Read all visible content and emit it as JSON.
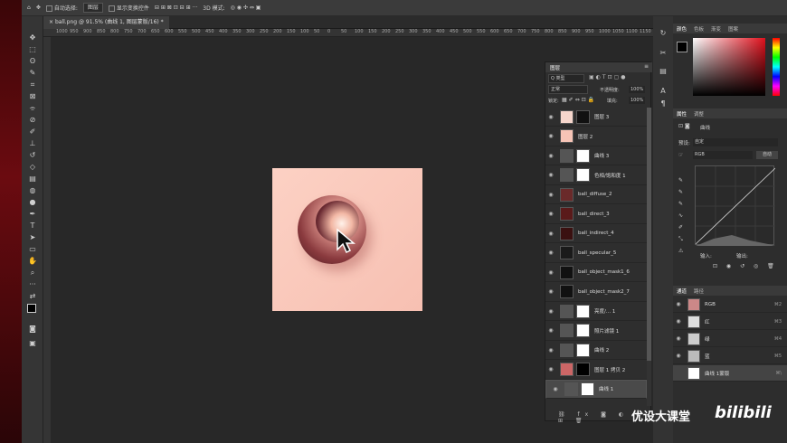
{
  "options_bar": {
    "auto_select": "自动选择:",
    "layer_select": "图层",
    "show_transform": "显示变换控件",
    "mode_3d": "3D 模式:"
  },
  "document_tab": "ball.png @ 91.5% (曲线 1, 图层蒙版/16) *",
  "ruler_ticks": [
    "1000",
    "950",
    "900",
    "850",
    "800",
    "750",
    "700",
    "650",
    "600",
    "550",
    "500",
    "450",
    "400",
    "350",
    "300",
    "250",
    "200",
    "150",
    "100",
    "50",
    "0",
    "50",
    "100",
    "150",
    "200",
    "250",
    "300",
    "350",
    "400",
    "450",
    "500",
    "550",
    "600",
    "650",
    "700",
    "750",
    "800",
    "850",
    "900",
    "950",
    "1000",
    "1050",
    "1100",
    "1150",
    "1200",
    "1250"
  ],
  "layers_panel": {
    "title": "图层",
    "filter_kind": "Q 类型",
    "blend_mode": "正常",
    "opacity_label": "不透明度:",
    "opacity_value": "100%",
    "lock_label": "锁定:",
    "fill_label": "填充:",
    "fill_value": "100%",
    "layers": [
      {
        "name": "图层 3",
        "thumb": "#f6d6cc",
        "mask": "#111"
      },
      {
        "name": "图层 2",
        "thumb": "#f6c4b6"
      },
      {
        "name": "曲线 3",
        "thumb": "#555",
        "mask": "#fff"
      },
      {
        "name": "色相/饱和度 1",
        "thumb": "#555",
        "mask": "#fff"
      },
      {
        "name": "ball_diffuse_2",
        "thumb": "#6a2a2a"
      },
      {
        "name": "ball_direct_3",
        "thumb": "#5a1a1a"
      },
      {
        "name": "ball_indirect_4",
        "thumb": "#3a1010"
      },
      {
        "name": "ball_specular_5",
        "thumb": "#1a1a1a"
      },
      {
        "name": "ball_object_mask1_6",
        "thumb": "#111"
      },
      {
        "name": "ball_object_mask2_7",
        "thumb": "#111"
      },
      {
        "name": "亮度/... 1",
        "thumb": "#555",
        "mask": "#fff"
      },
      {
        "name": "照片滤镜 1",
        "thumb": "#555",
        "mask": "#fff"
      },
      {
        "name": "曲线 2",
        "thumb": "#555",
        "mask": "#fff"
      },
      {
        "name": "图层 1 拷贝 2",
        "thumb": "#c66",
        "mask": "#000"
      },
      {
        "name": "曲线 1",
        "thumb": "#555",
        "mask": "#fff"
      }
    ]
  },
  "color_panel": {
    "tabs": [
      "颜色",
      "色板",
      "渐变",
      "图案"
    ]
  },
  "properties_panel": {
    "tabs": [
      "属性",
      "调整"
    ],
    "kind": "曲线",
    "preset_label": "预设:",
    "preset_value": "自定",
    "channel": "RGB",
    "auto_button": "自动",
    "input_label": "输入:",
    "output_label": "输出:"
  },
  "channels_panel": {
    "tabs": [
      "通道",
      "路径"
    ],
    "channels": [
      {
        "name": "RGB",
        "key": "⌘2"
      },
      {
        "name": "红",
        "key": "⌘3"
      },
      {
        "name": "绿",
        "key": "⌘4"
      },
      {
        "name": "蓝",
        "key": "⌘5"
      },
      {
        "name": "曲线 1蒙版",
        "key": "⌘\\"
      }
    ]
  },
  "watermark": "优设大课堂",
  "brand": "bilibili"
}
